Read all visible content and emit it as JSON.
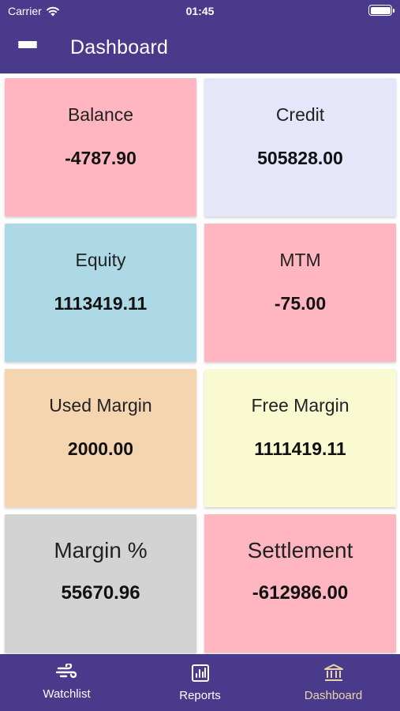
{
  "status_bar": {
    "carrier": "Carrier",
    "time": "01:45"
  },
  "header": {
    "title": "Dashboard",
    "menu_icon": "hamburger-menu-icon"
  },
  "cards": [
    {
      "label": "Balance",
      "value": "-4787.90",
      "color": "#ffb6c1"
    },
    {
      "label": "Credit",
      "value": "505828.00",
      "color": "#e6e6fa"
    },
    {
      "label": "Equity",
      "value": "1113419.11",
      "color": "#add8e6"
    },
    {
      "label": "MTM",
      "value": "-75.00",
      "color": "#ffb6c1"
    },
    {
      "label": "Used Margin",
      "value": "2000.00",
      "color": "#f5d5b0"
    },
    {
      "label": "Free Margin",
      "value": "1111419.11",
      "color": "#fafad2"
    },
    {
      "label": "Margin %",
      "value": "55670.96",
      "color": "#d3d3d3"
    },
    {
      "label": "Settlement",
      "value": "-612986.00",
      "color": "#ffb6c1"
    }
  ],
  "tabs": [
    {
      "label": "Watchlist",
      "icon": "wind-icon",
      "active": false
    },
    {
      "label": "Reports",
      "icon": "chart-icon",
      "active": false
    },
    {
      "label": "Dashboard",
      "icon": "bank-icon",
      "active": true
    }
  ],
  "colors": {
    "primary": "#4a3a8c",
    "active_tab": "#e8d6a8"
  }
}
